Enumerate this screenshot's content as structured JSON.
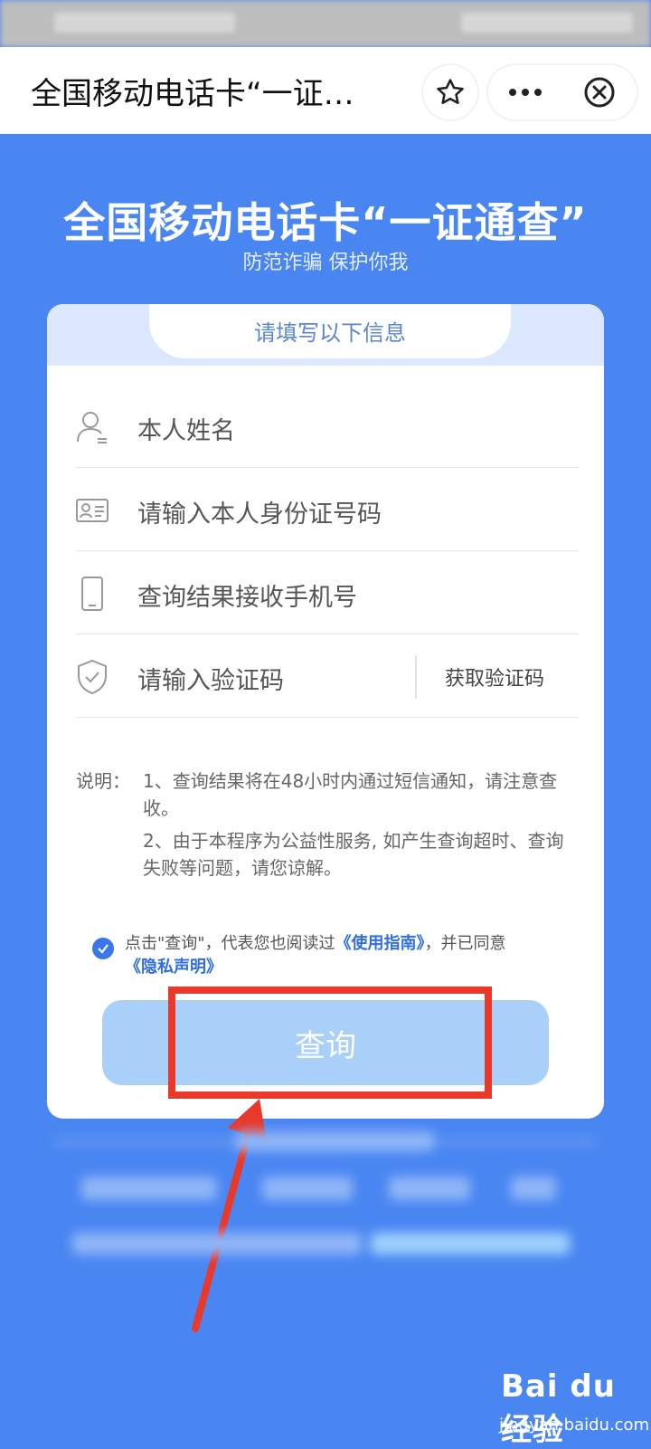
{
  "window": {
    "title": "全国移动电话卡“一证…"
  },
  "header": {
    "title": "全国移动电话卡“一证通查”",
    "subtitle": "防范诈骗 保护你我"
  },
  "form": {
    "section_title": "请填写以下信息",
    "name_placeholder": "本人姓名",
    "id_placeholder": "请输入本人身份证号码",
    "phone_placeholder": "查询结果接收手机号",
    "code_placeholder": "请输入验证码",
    "get_code_label": "获取验证码"
  },
  "notes": {
    "label": "说明：",
    "item1": "1、查询结果将在48小时内通过短信通知，请注意查收。",
    "item2": "2、由于本程序为公益性服务, 如产生查询超时、查询失败等问题，请您谅解。"
  },
  "agreement": {
    "prefix": "点击\"查询\"，代表您也阅读过",
    "guide_link": "《使用指南》",
    "middle": "，并已同意",
    "privacy_link": "《隐私声明》",
    "checked": true
  },
  "query_button": {
    "label": "查询"
  },
  "watermark": {
    "logo": "Bai du 经验",
    "url": "jingyan.baidu.com"
  },
  "colors": {
    "background": "#4a86f2",
    "button": "#a8d0f8",
    "highlight": "#e8392b",
    "link": "#2f6fe0"
  }
}
